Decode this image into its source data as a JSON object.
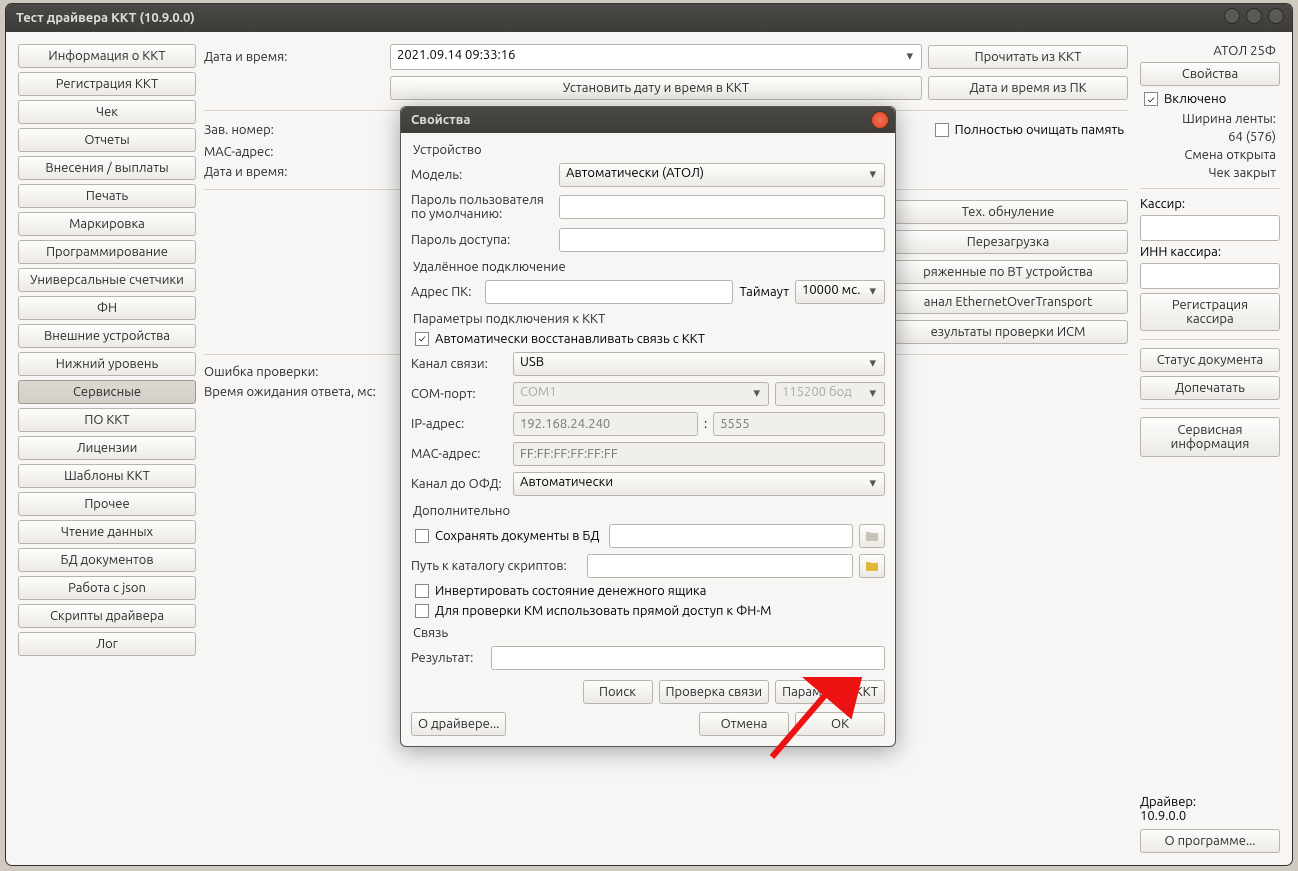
{
  "window": {
    "title": "Тест драйвера ККТ (10.9.0.0)"
  },
  "sidebar": {
    "items": [
      "Информация о ККТ",
      "Регистрация ККТ",
      "Чек",
      "Отчеты",
      "Внесения / выплаты",
      "Печать",
      "Маркировка",
      "Программирование",
      "Универсальные счетчики",
      "ФН",
      "Внешние устройства",
      "Нижний уровень",
      "Сервисные",
      "ПО ККТ",
      "Лицензии",
      "Шаблоны ККТ",
      "Прочее",
      "Чтение данных",
      "БД документов",
      "Работа с json",
      "Скрипты драйвера",
      "Лог"
    ],
    "active_index": 12
  },
  "main": {
    "datetime_label": "Дата и время:",
    "datetime_value": "2021.09.14 09:33:16",
    "read_from_kkt": "Прочитать из ККТ",
    "set_datetime": "Установить дату и время в ККТ",
    "datetime_from_pc": "Дата и время из ПК",
    "zav_nomer_label": "Зав. номер:",
    "mac_label": "MAC-адрес:",
    "datetime2_label": "Дата и время:",
    "clear_memory": "Полностью очищать память",
    "tech_reset": "Тех. обнуление",
    "reboot": "Перезагрузка",
    "bt_devices": "ряженные по BT устройства",
    "ethernet_channel": "анал EthernetOverTransport",
    "ism_check": "езультаты проверки ИСМ",
    "error_label": "Ошибка проверки:",
    "timeout_label": "Время ожидания ответа, мс:"
  },
  "right": {
    "device": "АТОЛ 25Ф",
    "properties": "Свойства",
    "enabled": "Включено",
    "width_label": "Ширина ленты:",
    "width_value": "64 (576)",
    "shift": "Смена открыта",
    "check": "Чек закрыт",
    "cashier_label": "Кассир:",
    "inn_label": "ИНН кассира:",
    "reg_cashier": "Регистрация кассира",
    "doc_status": "Статус документа",
    "reprint": "Допечатать",
    "service_info": "Сервисная информация",
    "driver_label": "Драйвер:",
    "driver_ver": "10.9.0.0",
    "about": "О программе..."
  },
  "dialog": {
    "title": "Свойства",
    "group_device": "Устройство",
    "model_label": "Модель:",
    "model_value": "Автоматически (АТОЛ)",
    "default_pwd_label": "Пароль пользователя по умолчанию:",
    "access_pwd_label": "Пароль доступа:",
    "group_remote": "Удалённое подключение",
    "pc_addr_label": "Адрес ПК:",
    "timeout_label": "Таймаут",
    "timeout_value": "10000 мс.",
    "group_params": "Параметры подключения к ККТ",
    "auto_reconnect": "Автоматически восстанавливать связь с ККТ",
    "channel_label": "Канал связи:",
    "channel_value": "USB",
    "com_label": "COM-порт:",
    "com_value": "COM1",
    "com_baud": "115200 бод",
    "ip_label": "IP-адрес:",
    "ip_value": "192.168.24.240",
    "ip_port": "5555",
    "mac_label": "MAC-адрес:",
    "mac_value": "FF:FF:FF:FF:FF:FF",
    "ofd_label": "Канал до ОФД:",
    "ofd_value": "Автоматически",
    "group_extra": "Дополнительно",
    "save_docs": "Сохранять документы в БД",
    "scripts_path_label": "Путь к каталогу скриптов:",
    "invert_drawer": "Инвертировать состояние денежного ящика",
    "km_direct": "Для проверки КМ использовать прямой доступ к ФН-М",
    "group_link": "Связь",
    "result_label": "Результат:",
    "search_btn": "Поиск",
    "check_btn": "Проверка связи",
    "kkt_params_btn": "Параметры ККТ",
    "about_btn": "О драйвере...",
    "cancel_btn": "Отмена",
    "ok_btn": "OK"
  }
}
